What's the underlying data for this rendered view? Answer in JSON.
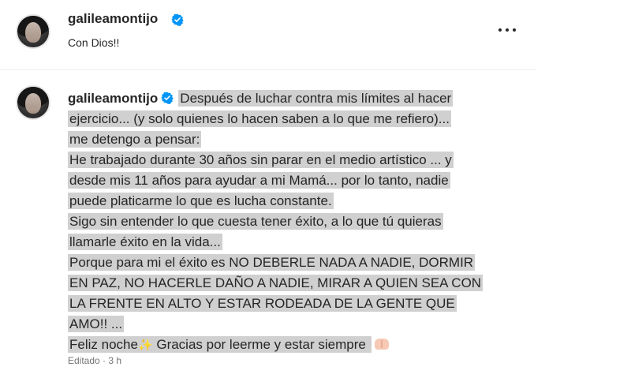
{
  "top_comment": {
    "username": "galileamontijo",
    "text": "Con Dios!!"
  },
  "caption": {
    "username": "galileamontijo",
    "lines": [
      "Después de luchar contra mis límites al hacer",
      "ejercicio... (y solo quienes lo hacen saben a lo que me refiero)...",
      "me detengo a pensar:",
      "He trabajado durante 30 años sin parar en el medio artístico ... y",
      "desde mis 11 años para ayudar a mi Mamá... por lo tanto, nadie",
      "puede platicarme lo que es lucha constante.",
      "Sigo sin entender lo que cuesta tener éxito, a lo que tú quieras",
      "llamarle éxito en la vida...",
      "Porque para mi el éxito es NO DEBERLE NADA A NADIE, DORMIR",
      "EN PAZ, NO HACERLE DAÑO A NADIE, MIRAR A QUIEN SEA CON",
      "LA FRENTE EN ALTO Y ESTAR RODEADA DE LA GENTE QUE",
      "AMO!! ..."
    ],
    "last_line_before": "Feliz noche",
    "last_line_after": " Gracias por leerme y estar siempre ",
    "sparkle_emoji": "✨",
    "status": "Editado · 3 h"
  },
  "icons": {
    "more": "more-options-icon",
    "verified": "verified-badge-icon",
    "sparkle": "sparkles-emoji",
    "hands": "praying-hands-emoji"
  },
  "colors": {
    "verified_blue": "#0095f6",
    "highlight": "#d0d0d0"
  }
}
